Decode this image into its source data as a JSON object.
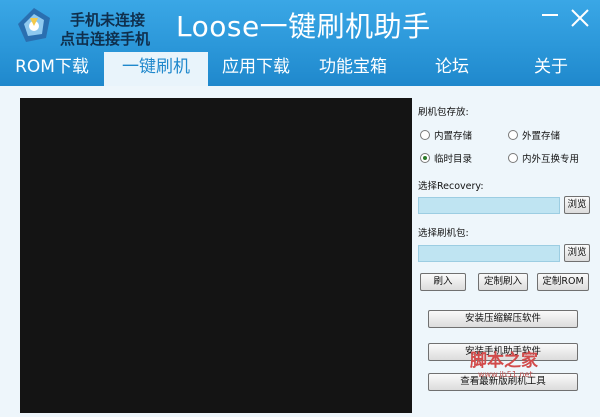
{
  "header": {
    "connection_line1": "手机未连接",
    "connection_line2": "点击连接手机",
    "title": "Loose一键刷机助手"
  },
  "tabs": [
    {
      "label": "ROM下载",
      "active": false
    },
    {
      "label": "一键刷机",
      "active": true
    },
    {
      "label": "应用下载",
      "active": false
    },
    {
      "label": "功能宝箱",
      "active": false
    },
    {
      "label": "论坛",
      "active": false
    },
    {
      "label": "关于",
      "active": false
    }
  ],
  "panel": {
    "storage_label": "刷机包存放:",
    "radio_internal": "内置存储",
    "radio_external": "外置存储",
    "radio_temp": "临时目录",
    "radio_swap": "内外互换专用",
    "selected_radio": "临时目录",
    "recovery_label": "选择Recovery:",
    "recovery_value": "",
    "browse1": "浏览",
    "package_label": "选择刷机包:",
    "package_value": "",
    "browse2": "浏览",
    "flash_btn": "刷入",
    "custom_flash_btn": "定制刷入",
    "custom_rom_btn": "定制ROM",
    "install_unzip_btn": "安装压缩解压软件",
    "install_helper_btn": "安装手机助手软件",
    "view_tools_btn": "查看最新版刷机工具"
  },
  "watermark": {
    "text": "脚本之家",
    "sub": "www.jb51.net"
  },
  "colors": {
    "header_blue": "#2b97d9",
    "active_tab_bg": "#e9f4fb",
    "input_bg": "#bfe4f2",
    "console_bg": "#141414"
  },
  "icons": [
    "app-logo-icon",
    "minimize-icon",
    "close-icon"
  ]
}
